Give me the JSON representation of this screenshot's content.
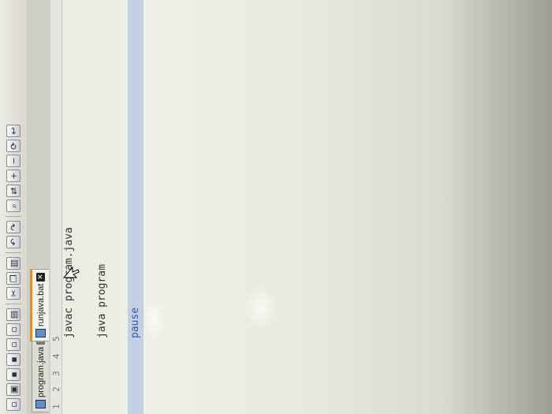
{
  "toolbar": {
    "icons": [
      "new-file-icon",
      "open-folder-icon",
      "save-icon",
      "save-all-icon",
      "close-icon",
      "close-all-icon",
      "print-icon",
      "cut-icon",
      "copy-icon",
      "paste-icon",
      "undo-icon",
      "redo-icon",
      "find-icon",
      "replace-icon",
      "zoom-in-icon",
      "zoom-out-icon",
      "sync-icon",
      "wrap-icon"
    ]
  },
  "tabs": [
    {
      "label": "program.java",
      "active": false
    },
    {
      "label": "runjava.bat",
      "active": true
    }
  ],
  "gutter": [
    "1",
    "2",
    "3",
    "4",
    "5"
  ],
  "lines": [
    {
      "line": "1",
      "text": "javac program.java"
    },
    {
      "line": "2",
      "text": ""
    },
    {
      "line": "3",
      "text": "java program"
    },
    {
      "line": "4",
      "text": ""
    },
    {
      "line": "5",
      "text": "pause"
    }
  ],
  "colors": {
    "accent": "#f08c1e",
    "current_line": "#c3cfe3",
    "keyword": "#2b5ca8"
  }
}
